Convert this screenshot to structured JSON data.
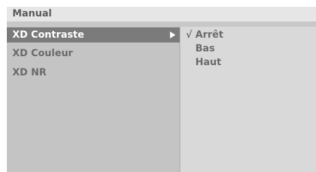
{
  "header": {
    "title": "Manual"
  },
  "menu": {
    "items": [
      {
        "label": "XD Contraste",
        "selected": true
      },
      {
        "label": "XD Couleur",
        "selected": false
      },
      {
        "label": "XD NR",
        "selected": false
      }
    ]
  },
  "options": {
    "check_mark": "√",
    "items": [
      {
        "label": "Arrêt",
        "checked": true
      },
      {
        "label": "Bas",
        "checked": false
      },
      {
        "label": "Haut",
        "checked": false
      }
    ]
  },
  "colors": {
    "selection_bg": "#7b7b7b",
    "menu_bg": "#c4c4c4",
    "options_bg": "#d9d9d9",
    "header_bg": "#e6e6e6"
  }
}
